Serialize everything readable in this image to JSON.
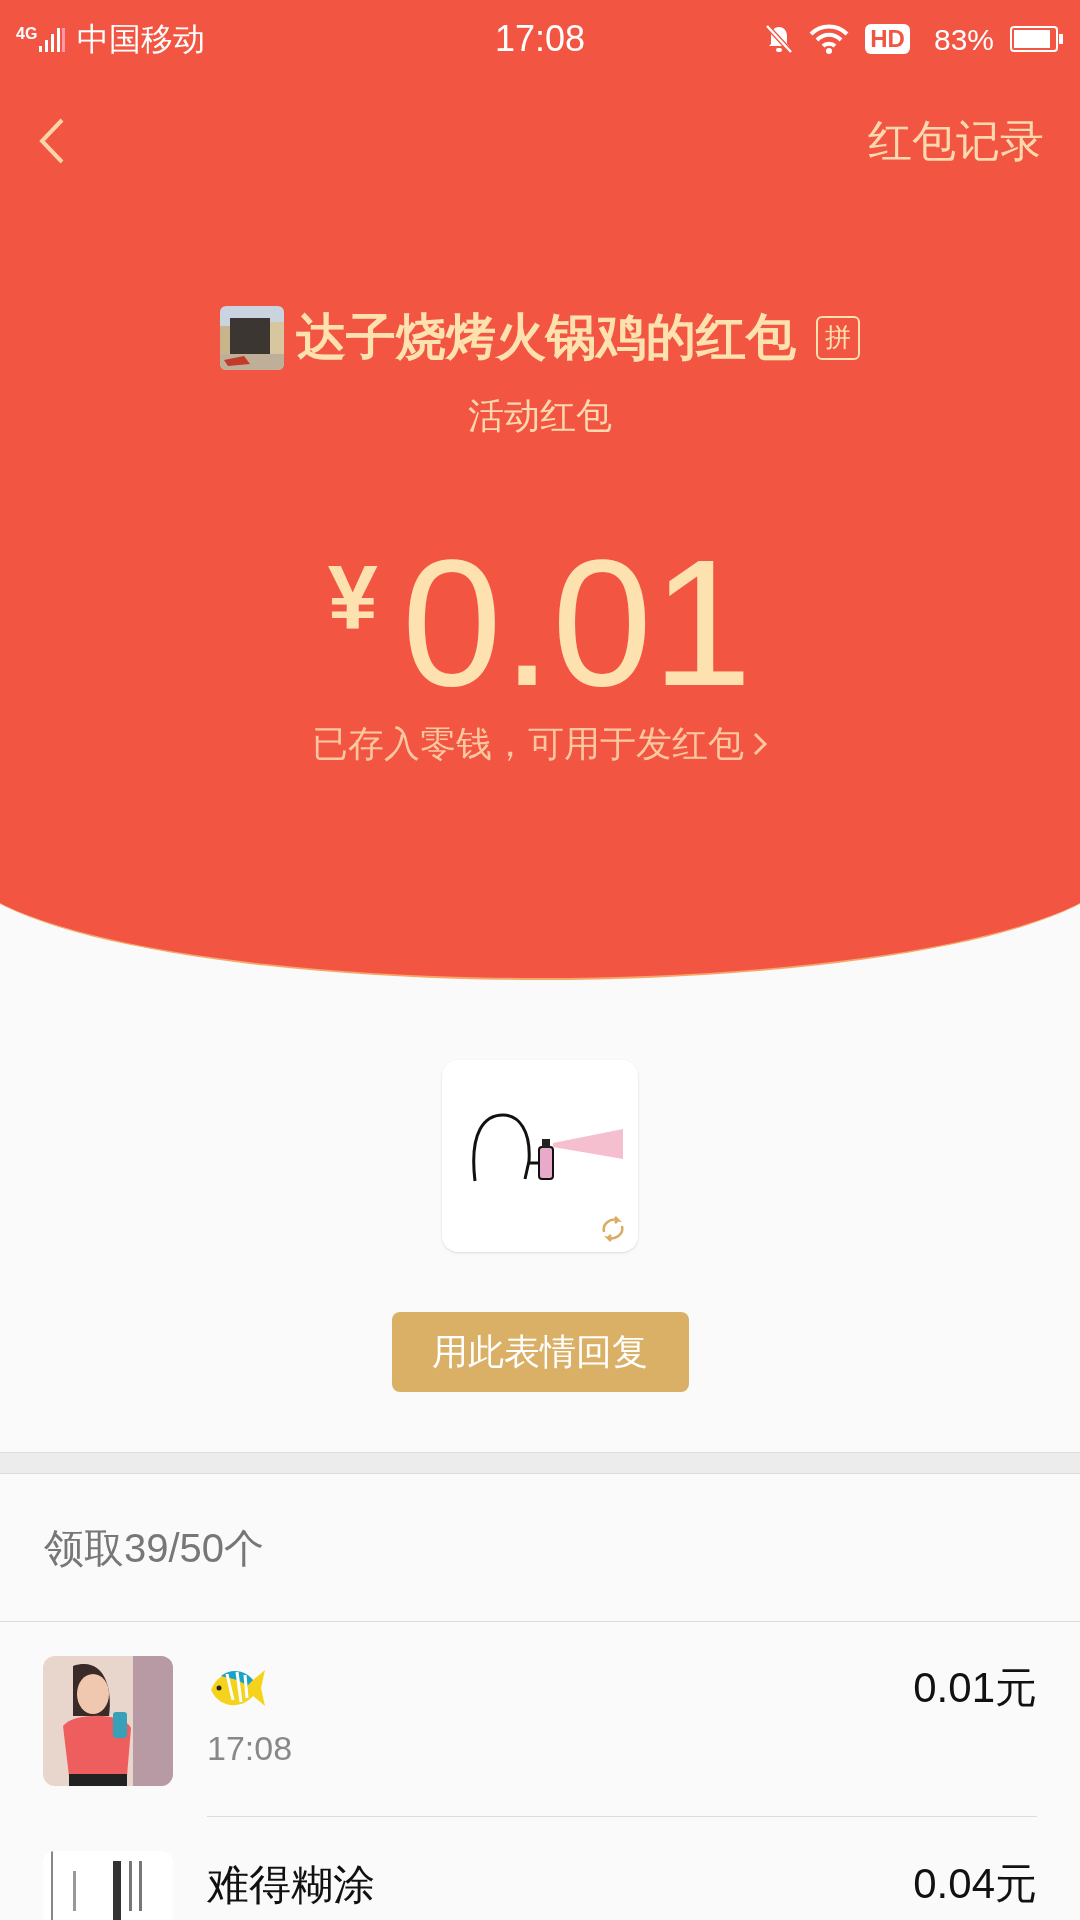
{
  "status_bar": {
    "network": "4G",
    "carrier": "中国移动",
    "time": "17:08",
    "hd": "HD",
    "battery": "83%"
  },
  "nav": {
    "records_link": "红包记录"
  },
  "packet": {
    "sender": "达子烧烤火锅鸡的红包",
    "badge": "拼",
    "type": "活动红包",
    "currency": "¥",
    "amount": "0.01",
    "note": "已存入零钱，可用于发红包"
  },
  "reply_button": "用此表情回复",
  "summary": "领取39/50个",
  "recipients": [
    {
      "kind": "emoji",
      "time": "17:08",
      "amount": "0.01元"
    },
    {
      "kind": "text",
      "name": "难得糊涂",
      "amount": "0.04元"
    }
  ]
}
